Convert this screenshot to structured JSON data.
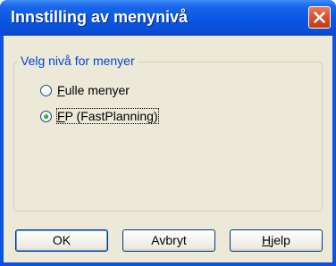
{
  "window": {
    "title": "Innstilling av menynivå"
  },
  "group": {
    "label": "Velg nivå for menyer",
    "options": [
      {
        "accel": "F",
        "rest": "ulle menyer",
        "selected": false
      },
      {
        "accel": "F",
        "rest": "P (FastPlanning)",
        "selected": true
      }
    ]
  },
  "buttons": {
    "ok": "OK",
    "cancel": "Avbryt",
    "help_accel": "H",
    "help_rest": "jelp"
  },
  "colors": {
    "title_bar": "#0856e4",
    "close_button": "#d9502a",
    "group_label": "#0046d5",
    "dialog_bg": "#ece9d8"
  },
  "icons": {
    "close": "close-icon"
  }
}
